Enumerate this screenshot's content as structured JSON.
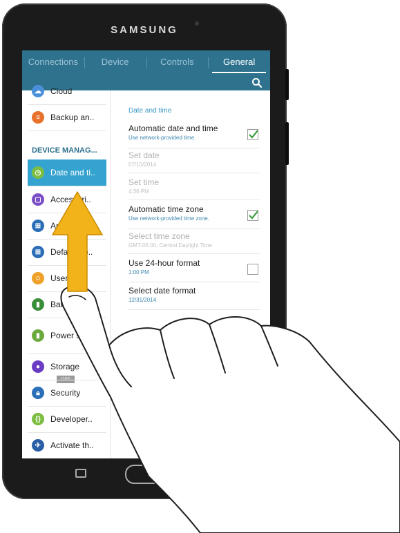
{
  "device": {
    "brand": "SAMSUNG"
  },
  "tabs": [
    {
      "label": "Connections",
      "active": false
    },
    {
      "label": "Device",
      "active": false
    },
    {
      "label": "Controls",
      "active": false
    },
    {
      "label": "General",
      "active": true
    }
  ],
  "sidebar": {
    "section_header": "DEVICE MANAG...",
    "tag": "OFF",
    "items": [
      {
        "label": "Cloud",
        "icon": "cloud-icon",
        "color": "#4a90d9"
      },
      {
        "label": "Backup an..",
        "icon": "backup-icon",
        "color": "#e8712b"
      },
      {
        "label": "Date and ti..",
        "icon": "date-time-icon",
        "color": "#7cbd42",
        "selected": true
      },
      {
        "label": "Accessori..",
        "icon": "accessories-icon",
        "color": "#7b4fc9"
      },
      {
        "label": "Applicatio..",
        "icon": "applications-icon",
        "color": "#2a6fb7"
      },
      {
        "label": "Default ap..",
        "icon": "default-apps-icon",
        "color": "#2a6fb7"
      },
      {
        "label": "Users",
        "icon": "users-icon",
        "color": "#f0a12a"
      },
      {
        "label": "Battery",
        "icon": "battery-icon",
        "color": "#3a8e3a"
      },
      {
        "label": "Power saving",
        "icon": "power-saving-icon",
        "color": "#6aa93c"
      },
      {
        "label": "Storage",
        "icon": "storage-icon",
        "color": "#6a3cc4"
      },
      {
        "label": "Security",
        "icon": "security-icon",
        "color": "#2a6fb7"
      },
      {
        "label": "Developer..",
        "icon": "developer-icon",
        "color": "#7cbd42"
      },
      {
        "label": "Activate th..",
        "icon": "activate-icon",
        "color": "#2a5fa8"
      }
    ]
  },
  "settings": {
    "section_title": "Date and time",
    "rows": [
      {
        "title": "Automatic date and time",
        "subtitle": "Use network-provided time.",
        "checkbox": true,
        "checked": true,
        "enabled": true
      },
      {
        "title": "Set date",
        "subtitle": "07/10/2014",
        "checkbox": false,
        "enabled": false
      },
      {
        "title": "Set time",
        "subtitle": "4:36 PM",
        "checkbox": false,
        "enabled": false
      },
      {
        "title": "Automatic time zone",
        "subtitle": "Use network-provided time zone.",
        "checkbox": true,
        "checked": true,
        "enabled": true
      },
      {
        "title": "Select time zone",
        "subtitle": "GMT-05:00, Central Daylight Time",
        "checkbox": false,
        "enabled": false
      },
      {
        "title": "Use 24-hour format",
        "subtitle": "1:00 PM",
        "checkbox": true,
        "checked": false,
        "enabled": true
      },
      {
        "title": "Select date format",
        "subtitle": "12/31/2014",
        "checkbox": false,
        "enabled": true
      }
    ]
  },
  "colors": {
    "tab_bar": "#2e728e",
    "selected_item": "#35a3cf",
    "checkmark": "#3a9a3a",
    "gesture_arrow": "#f2b31a"
  },
  "gesture": {
    "type": "swipe-up",
    "icon": "swipe-up-arrow-icon"
  }
}
